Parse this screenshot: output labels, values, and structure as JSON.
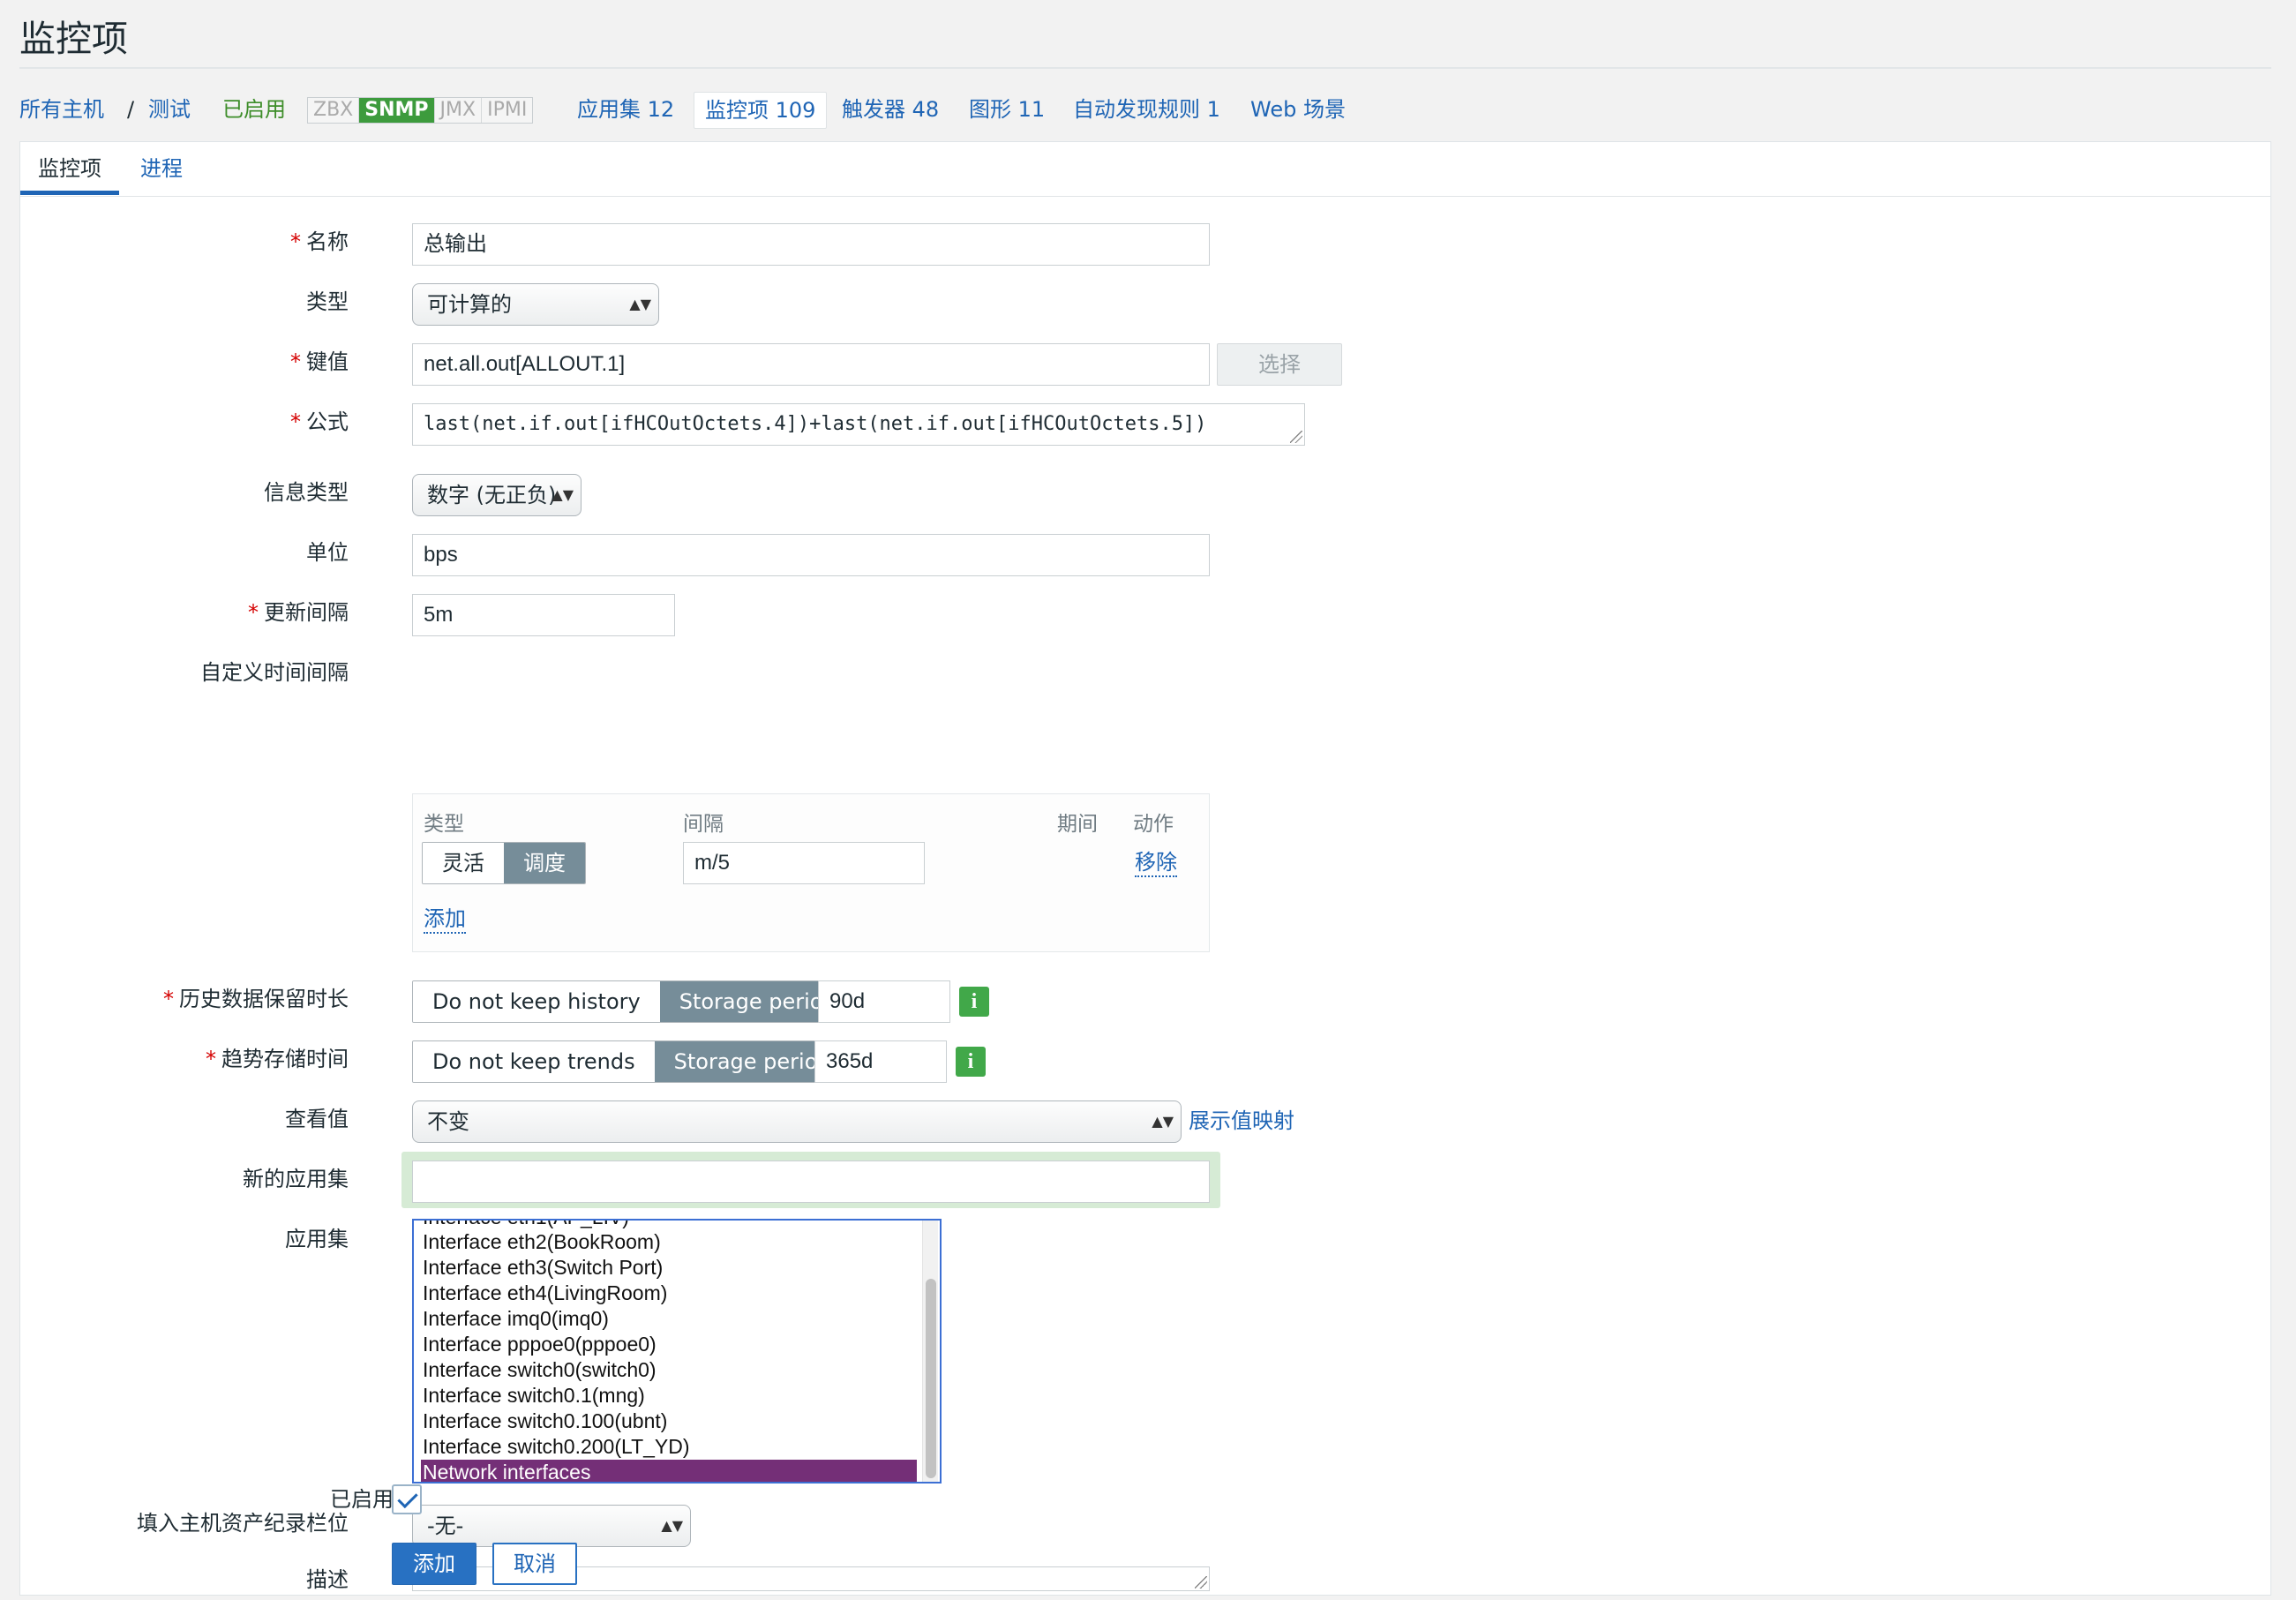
{
  "page": {
    "title": "监控项"
  },
  "nav": {
    "all_hosts": "所有主机",
    "sep": "/",
    "host": "测试",
    "enabled": "已启用",
    "protocols": [
      {
        "label": "ZBX",
        "active": false
      },
      {
        "label": "SNMP",
        "active": true
      },
      {
        "label": "JMX",
        "active": false
      },
      {
        "label": "IPMI",
        "active": false
      }
    ],
    "applications": "应用集 12",
    "items": "监控项 109",
    "triggers": "触发器 48",
    "graphs": "图形 11",
    "discovery": "自动发现规则 1",
    "web": "Web 场景"
  },
  "tabs": {
    "item": "监控项",
    "process": "进程"
  },
  "form": {
    "name": {
      "label": "名称",
      "value": "总输出"
    },
    "type": {
      "label": "类型",
      "value": "可计算的"
    },
    "key": {
      "label": "键值",
      "value": "net.all.out[ALLOUT.1]",
      "select_button": "选择"
    },
    "formula": {
      "label": "公式",
      "value": "last(net.if.out[ifHCOutOctets.4])+last(net.if.out[ifHCOutOctets.5])"
    },
    "info_type": {
      "label": "信息类型",
      "value": "数字 (无正负)"
    },
    "units": {
      "label": "单位",
      "value": "bps"
    },
    "update_interval": {
      "label": "更新间隔",
      "value": "5m"
    },
    "custom_intervals": {
      "label": "自定义时间间隔",
      "col_type": "类型",
      "col_interval": "间隔",
      "col_period": "期间",
      "col_action": "动作",
      "flexible": "灵活",
      "scheduling": "调度",
      "interval_value": "m/5",
      "remove": "移除",
      "add": "添加"
    },
    "history": {
      "label": "历史数据保留时长",
      "no_keep": "Do not keep history",
      "storage": "Storage period",
      "value": "90d"
    },
    "trends": {
      "label": "趋势存储时间",
      "no_keep": "Do not keep trends",
      "storage": "Storage period",
      "value": "365d"
    },
    "show_value": {
      "label": "查看值",
      "value": "不变",
      "link": "展示值映射"
    },
    "new_application": {
      "label": "新的应用集",
      "value": ""
    },
    "applications": {
      "label": "应用集",
      "options": [
        "Interface eth2(BookRoom)",
        "Interface eth3(Switch Port)",
        "Interface eth4(LivingRoom)",
        "Interface imq0(imq0)",
        "Interface pppoe0(pppoe0)",
        "Interface switch0(switch0)",
        "Interface switch0.1(mng)",
        "Interface switch0.100(ubnt)",
        "Interface switch0.200(LT_YD)"
      ],
      "selected": "Network interfaces"
    },
    "inventory": {
      "label": "填入主机资产纪录栏位",
      "value": "-无-"
    },
    "description": {
      "label": "描述",
      "value": ""
    },
    "enabled": {
      "label": "已启用",
      "checked": true
    },
    "add_button": "添加",
    "cancel_button": "取消"
  },
  "colors": {
    "link": "#1f65b5",
    "enabled_green": "#3d8d29",
    "snmp_green": "#3d9b3d",
    "selected_option": "#742f77",
    "segment_active": "#768d99",
    "primary_button": "#2871c2"
  }
}
